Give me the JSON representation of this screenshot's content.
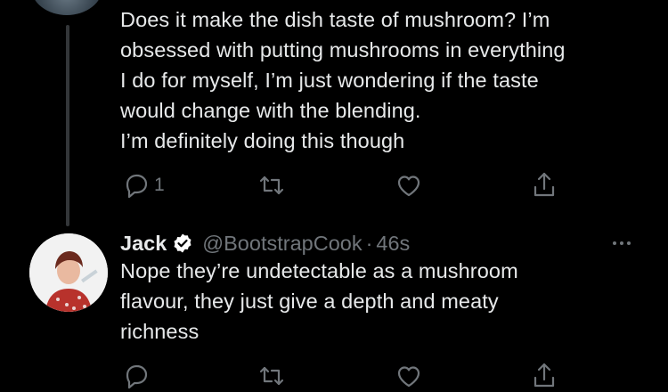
{
  "parent_tweet": {
    "text": "Does it make the dish taste of mushroom? I’m\nobsessed with putting mushrooms in everything\nI do for myself, I’m just wondering if the taste\nwould change with the blending.\nI’m definitely doing this though",
    "reply_count": "1"
  },
  "reply_tweet": {
    "name": "Jack",
    "handle": "@BootstrapCook",
    "separator": "·",
    "time": "46s",
    "text": "Nope they’re undetectable as a mushroom\nflavour, they just give a depth and meaty\nrichness"
  },
  "colors": {
    "background": "#000000",
    "text": "#e7e9ea",
    "muted": "#71767b",
    "verified": "#ffffff"
  }
}
